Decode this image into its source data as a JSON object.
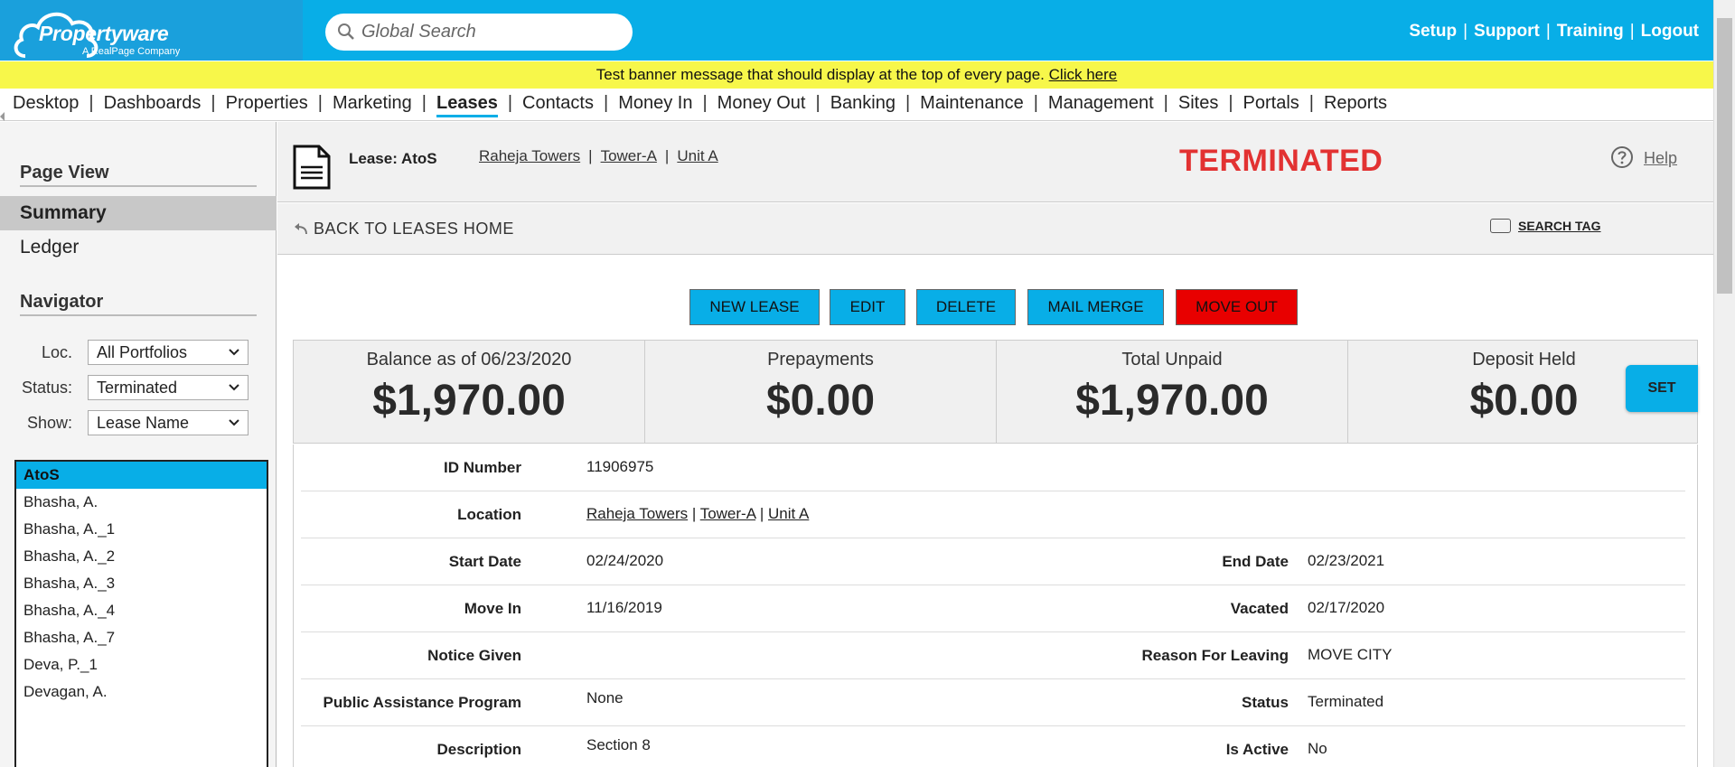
{
  "app": {
    "logo_text": "Propertyware",
    "logo_sub": "A RealPage Company"
  },
  "search": {
    "placeholder": "Global Search"
  },
  "toplinks": [
    "Setup",
    "Support",
    "Training",
    "Logout"
  ],
  "banner": {
    "message": "Test banner message that should display at the top of every page.",
    "link": "Click here"
  },
  "nav": {
    "items": [
      "Desktop",
      "Dashboards",
      "Properties",
      "Marketing",
      "Leases",
      "Contacts",
      "Money In",
      "Money Out",
      "Banking",
      "Maintenance",
      "Management",
      "Sites",
      "Portals",
      "Reports"
    ],
    "active": "Leases"
  },
  "sidebar": {
    "page_view_heading": "Page View",
    "views": [
      "Summary",
      "Ledger"
    ],
    "active_view": "Summary",
    "navigator_heading": "Navigator",
    "filters": {
      "loc_label": "Loc.",
      "loc_value": "All Portfolios",
      "status_label": "Status:",
      "status_value": "Terminated",
      "show_label": "Show:",
      "show_value": "Lease Name"
    },
    "leases": [
      "AtoS",
      "Bhasha, A.",
      "Bhasha, A._1",
      "Bhasha, A._2",
      "Bhasha, A._3",
      "Bhasha, A._4",
      "Bhasha, A._7",
      "Deva, P._1",
      "Devagan, A."
    ],
    "selected_lease": "AtoS"
  },
  "header": {
    "lease_title": "Lease: AtoS",
    "location_links": [
      "Raheja Towers",
      "Tower-A",
      "Unit A"
    ],
    "status": "TERMINATED",
    "help": "Help"
  },
  "backbar": {
    "back": "BACK TO LEASES HOME",
    "search_tag": "SEARCH TAG"
  },
  "actions": {
    "new_lease": "NEW LEASE",
    "edit": "EDIT",
    "delete": "DELETE",
    "mail_merge": "MAIL MERGE",
    "move_out": "MOVE OUT",
    "set": "SET"
  },
  "summary": [
    {
      "label": "Balance as of 06/23/2020",
      "value": "$1,970.00"
    },
    {
      "label": "Prepayments",
      "value": "$0.00"
    },
    {
      "label": "Total Unpaid",
      "value": "$1,970.00"
    },
    {
      "label": "Deposit Held",
      "value": "$0.00"
    }
  ],
  "details": {
    "id_number_label": "ID Number",
    "id_number": "11906975",
    "location_label": "Location",
    "start_date_label": "Start Date",
    "start_date": "02/24/2020",
    "end_date_label": "End Date",
    "end_date": "02/23/2021",
    "move_in_label": "Move In",
    "move_in": "11/16/2019",
    "vacated_label": "Vacated",
    "vacated": "02/17/2020",
    "notice_given_label": "Notice Given",
    "notice_given": "",
    "reason_label": "Reason For Leaving",
    "reason": "MOVE CITY",
    "public_assistance_label": "Public Assistance Program",
    "public_assistance": "None",
    "status_label": "Status",
    "status": "Terminated",
    "description_label": "Description",
    "description": "Section 8",
    "is_active_label": "Is Active",
    "is_active": "No"
  },
  "colors": {
    "brand_blue": "#08aee7",
    "banner_yellow": "#f7f74a",
    "terminated_red": "#e23232",
    "move_out_red": "#e80000"
  }
}
